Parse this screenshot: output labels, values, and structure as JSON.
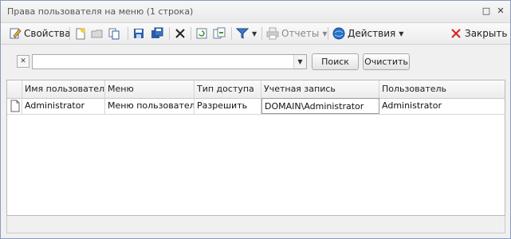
{
  "window": {
    "title": "Права пользователя на меню (1 строка)",
    "restore_glyph": "□",
    "close_glyph": "✕"
  },
  "toolbar": {
    "properties_label": "Свойства",
    "reports_label": "Отчеты",
    "actions_label": "Действия",
    "close_label": "Закрыть"
  },
  "filter": {
    "search_value": "",
    "search_label": "Поиск",
    "clear_label": "Очистить"
  },
  "grid": {
    "columns": [
      "Имя пользователя",
      "Меню",
      "Тип доступа",
      "Учетная запись",
      "Пользователь"
    ],
    "rows": [
      {
        "user_name": "Administrator",
        "menu": "Меню пользователя",
        "access_type": "Разрешить",
        "account": "DOMAIN\\Administrator",
        "user": "Administrator"
      }
    ]
  },
  "icons": [
    "edit-icon",
    "new-icon",
    "folder-icon",
    "copy-icon",
    "save-icon",
    "save-all-icon",
    "delete-icon",
    "refresh-icon",
    "export-icon",
    "filter-icon",
    "print-icon",
    "globe-icon",
    "close-icon"
  ],
  "colors": {
    "accent": "#2c5ea8",
    "close_red": "#d8262c"
  }
}
